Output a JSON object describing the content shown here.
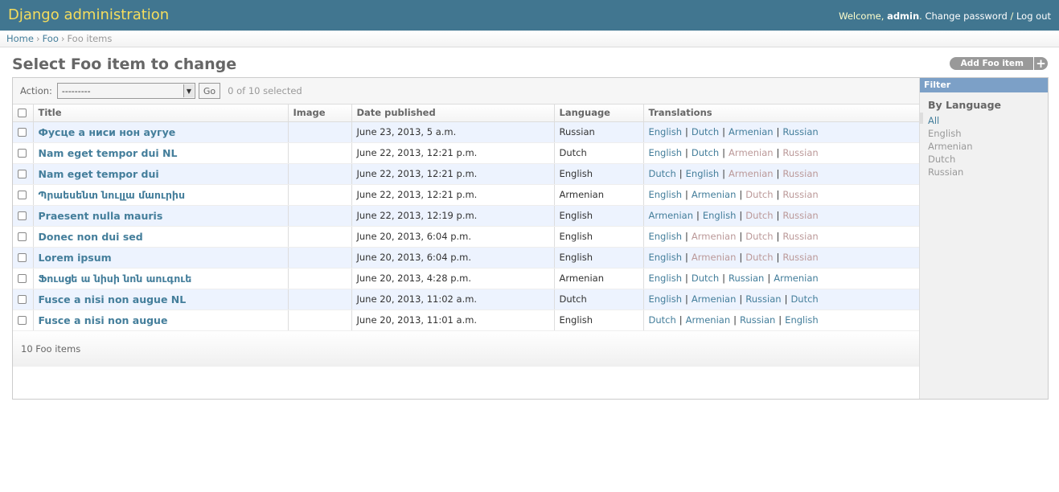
{
  "header": {
    "site_name": "Django administration",
    "welcome": "Welcome,",
    "username": "admin",
    "change_password": "Change password",
    "separator": "/",
    "logout": "Log out"
  },
  "breadcrumbs": {
    "home": "Home",
    "app": "Foo",
    "current": "Foo items",
    "sep": "›"
  },
  "page_title": "Select Foo item to change",
  "add_button": "Add Foo item",
  "actions": {
    "label": "Action:",
    "selected": "---------",
    "go": "Go",
    "counter": "0 of 10 selected"
  },
  "columns": [
    "Title",
    "Image",
    "Date published",
    "Language",
    "Translations"
  ],
  "rows": [
    {
      "title": "Фусце а ниси нон аугуе",
      "image": "",
      "date": "June 23, 2013, 5 a.m.",
      "language": "Russian",
      "translations": [
        {
          "label": "English",
          "active": true
        },
        {
          "label": "Dutch",
          "active": true
        },
        {
          "label": "Armenian",
          "active": true
        },
        {
          "label": "Russian",
          "active": true
        }
      ]
    },
    {
      "title": "Nam eget tempor dui NL",
      "image": "",
      "date": "June 22, 2013, 12:21 p.m.",
      "language": "Dutch",
      "translations": [
        {
          "label": "English",
          "active": true
        },
        {
          "label": "Dutch",
          "active": true
        },
        {
          "label": "Armenian",
          "active": false
        },
        {
          "label": "Russian",
          "active": false
        }
      ]
    },
    {
      "title": "Nam eget tempor dui",
      "image": "",
      "date": "June 22, 2013, 12:21 p.m.",
      "language": "English",
      "translations": [
        {
          "label": "Dutch",
          "active": true
        },
        {
          "label": "English",
          "active": true
        },
        {
          "label": "Armenian",
          "active": false
        },
        {
          "label": "Russian",
          "active": false
        }
      ]
    },
    {
      "title": "Պրաեսենտ նուլլա մաուրիս",
      "image": "",
      "date": "June 22, 2013, 12:21 p.m.",
      "language": "Armenian",
      "translations": [
        {
          "label": "English",
          "active": true
        },
        {
          "label": "Armenian",
          "active": true
        },
        {
          "label": "Dutch",
          "active": false
        },
        {
          "label": "Russian",
          "active": false
        }
      ]
    },
    {
      "title": "Praesent nulla mauris",
      "image": "",
      "date": "June 22, 2013, 12:19 p.m.",
      "language": "English",
      "translations": [
        {
          "label": "Armenian",
          "active": true
        },
        {
          "label": "English",
          "active": true
        },
        {
          "label": "Dutch",
          "active": false
        },
        {
          "label": "Russian",
          "active": false
        }
      ]
    },
    {
      "title": "Donec non dui sed",
      "image": "",
      "date": "June 20, 2013, 6:04 p.m.",
      "language": "English",
      "translations": [
        {
          "label": "English",
          "active": true
        },
        {
          "label": "Armenian",
          "active": false
        },
        {
          "label": "Dutch",
          "active": false
        },
        {
          "label": "Russian",
          "active": false
        }
      ]
    },
    {
      "title": "Lorem ipsum",
      "image": "",
      "date": "June 20, 2013, 6:04 p.m.",
      "language": "English",
      "translations": [
        {
          "label": "English",
          "active": true
        },
        {
          "label": "Armenian",
          "active": false
        },
        {
          "label": "Dutch",
          "active": false
        },
        {
          "label": "Russian",
          "active": false
        }
      ]
    },
    {
      "title": "Ֆուսցե ա նիսի նոն աուգուե",
      "image": "",
      "date": "June 20, 2013, 4:28 p.m.",
      "language": "Armenian",
      "translations": [
        {
          "label": "English",
          "active": true
        },
        {
          "label": "Dutch",
          "active": true
        },
        {
          "label": "Russian",
          "active": true
        },
        {
          "label": "Armenian",
          "active": true
        }
      ]
    },
    {
      "title": "Fusce a nisi non augue NL",
      "image": "",
      "date": "June 20, 2013, 11:02 a.m.",
      "language": "Dutch",
      "translations": [
        {
          "label": "English",
          "active": true
        },
        {
          "label": "Armenian",
          "active": true
        },
        {
          "label": "Russian",
          "active": true
        },
        {
          "label": "Dutch",
          "active": true
        }
      ]
    },
    {
      "title": "Fusce a nisi non augue",
      "image": "",
      "date": "June 20, 2013, 11:01 a.m.",
      "language": "English",
      "translations": [
        {
          "label": "Dutch",
          "active": true
        },
        {
          "label": "Armenian",
          "active": true
        },
        {
          "label": "Russian",
          "active": true
        },
        {
          "label": "English",
          "active": true
        }
      ]
    }
  ],
  "paginator": "10 Foo items",
  "filter": {
    "title": "Filter",
    "heading": "By Language",
    "options": [
      {
        "label": "All",
        "selected": true
      },
      {
        "label": "English",
        "selected": false
      },
      {
        "label": "Armenian",
        "selected": false
      },
      {
        "label": "Dutch",
        "selected": false
      },
      {
        "label": "Russian",
        "selected": false
      }
    ]
  },
  "colors": {
    "header_bg": "#417690",
    "branding": "#f5dd5d",
    "link": "#447e9b",
    "inactive_translation": "#b99",
    "row_alt": "#edf3fe",
    "filter_header": "#7ca0c7"
  }
}
